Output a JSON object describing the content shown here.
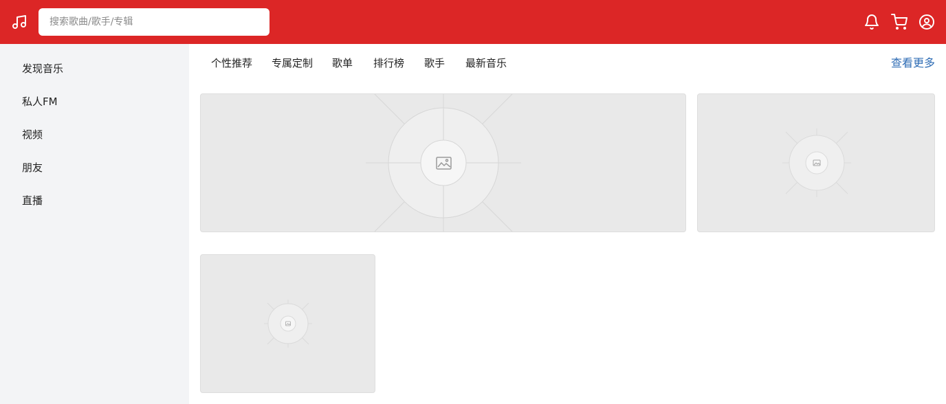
{
  "app": {
    "logo_icon": "music-note-icon",
    "accent_color": "#dc2626",
    "link_color": "#2f6db5"
  },
  "search": {
    "placeholder": "搜索歌曲/歌手/专辑",
    "value": ""
  },
  "header_icons": [
    "bell-icon",
    "cart-icon",
    "user-circle-icon"
  ],
  "sidebar": {
    "items": [
      {
        "label": "发现音乐"
      },
      {
        "label": "私人FM"
      },
      {
        "label": "视频"
      },
      {
        "label": "朋友"
      },
      {
        "label": "直播"
      }
    ]
  },
  "tabs": [
    {
      "label": "个性推荐"
    },
    {
      "label": "专属定制"
    },
    {
      "label": "歌单"
    },
    {
      "label": "排行榜"
    },
    {
      "label": "歌手"
    },
    {
      "label": "最新音乐"
    }
  ],
  "more_link": "查看更多",
  "cards": [
    {
      "placeholder_icon": "image-placeholder-icon"
    },
    {
      "placeholder_icon": "image-placeholder-icon"
    },
    {
      "placeholder_icon": "image-placeholder-icon"
    }
  ]
}
